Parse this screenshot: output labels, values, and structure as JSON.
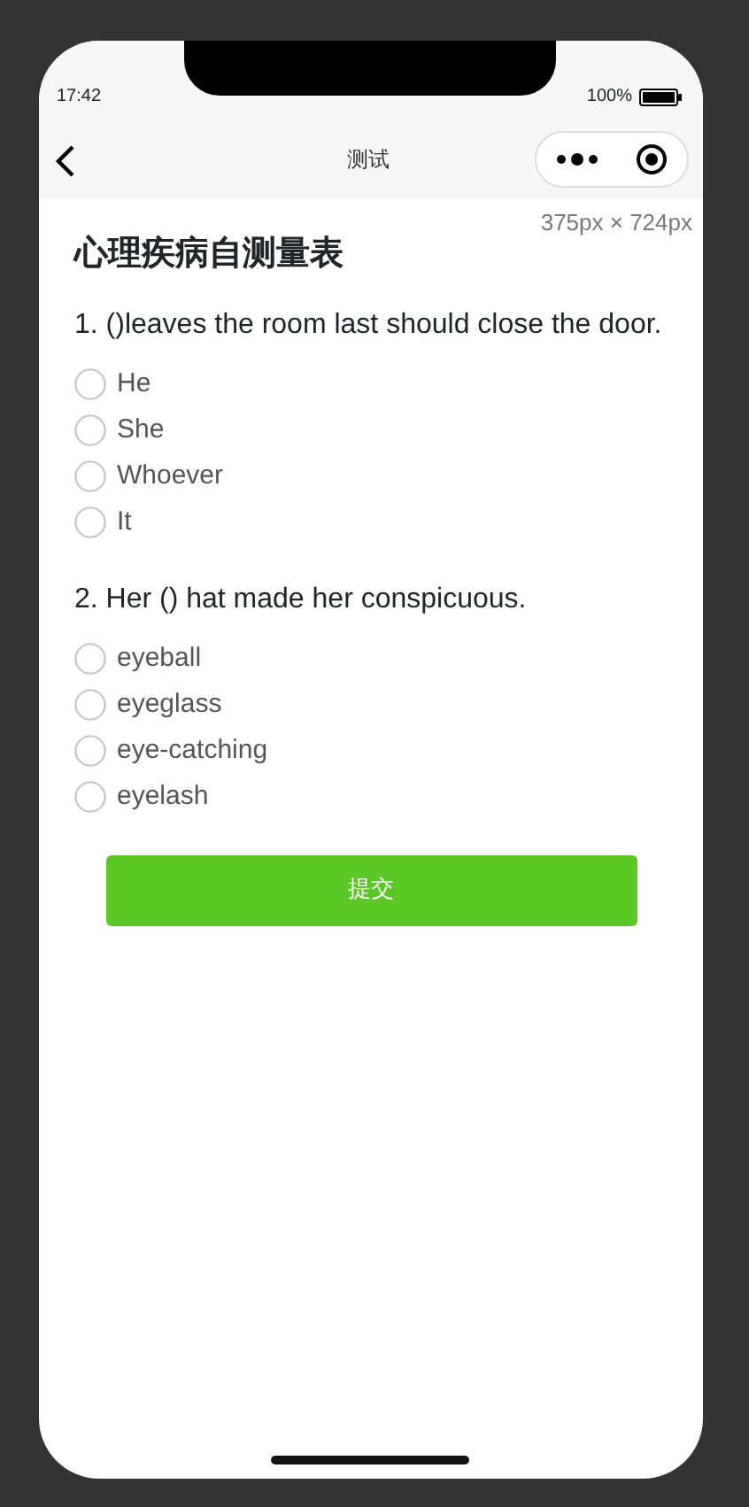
{
  "status_bar": {
    "time": "17:42",
    "battery": "100%"
  },
  "nav_bar": {
    "title": "测试"
  },
  "size_label": "375px × 724px",
  "page_title": "心理疾病自测量表",
  "questions": [
    {
      "text": "1. ()leaves the room last should close the door.",
      "options": [
        {
          "label": "He",
          "selected": false
        },
        {
          "label": "She",
          "selected": false
        },
        {
          "label": "Whoever",
          "selected": false
        },
        {
          "label": "It",
          "selected": false
        }
      ]
    },
    {
      "text": "2. Her () hat made her conspicuous.",
      "options": [
        {
          "label": "eyeball",
          "selected": false
        },
        {
          "label": "eyeglass",
          "selected": false
        },
        {
          "label": "eye-catching",
          "selected": false
        },
        {
          "label": "eyelash",
          "selected": false
        }
      ]
    }
  ],
  "submit_button": "提交"
}
